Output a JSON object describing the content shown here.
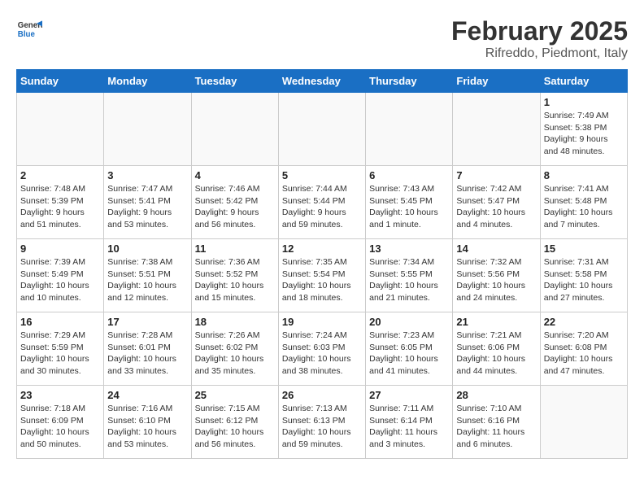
{
  "logo": {
    "line1": "General",
    "line2": "Blue"
  },
  "title": "February 2025",
  "subtitle": "Rifreddo, Piedmont, Italy",
  "days_of_week": [
    "Sunday",
    "Monday",
    "Tuesday",
    "Wednesday",
    "Thursday",
    "Friday",
    "Saturday"
  ],
  "weeks": [
    [
      {
        "day": "",
        "info": ""
      },
      {
        "day": "",
        "info": ""
      },
      {
        "day": "",
        "info": ""
      },
      {
        "day": "",
        "info": ""
      },
      {
        "day": "",
        "info": ""
      },
      {
        "day": "",
        "info": ""
      },
      {
        "day": "1",
        "info": "Sunrise: 7:49 AM\nSunset: 5:38 PM\nDaylight: 9 hours and 48 minutes."
      }
    ],
    [
      {
        "day": "2",
        "info": "Sunrise: 7:48 AM\nSunset: 5:39 PM\nDaylight: 9 hours and 51 minutes."
      },
      {
        "day": "3",
        "info": "Sunrise: 7:47 AM\nSunset: 5:41 PM\nDaylight: 9 hours and 53 minutes."
      },
      {
        "day": "4",
        "info": "Sunrise: 7:46 AM\nSunset: 5:42 PM\nDaylight: 9 hours and 56 minutes."
      },
      {
        "day": "5",
        "info": "Sunrise: 7:44 AM\nSunset: 5:44 PM\nDaylight: 9 hours and 59 minutes."
      },
      {
        "day": "6",
        "info": "Sunrise: 7:43 AM\nSunset: 5:45 PM\nDaylight: 10 hours and 1 minute."
      },
      {
        "day": "7",
        "info": "Sunrise: 7:42 AM\nSunset: 5:47 PM\nDaylight: 10 hours and 4 minutes."
      },
      {
        "day": "8",
        "info": "Sunrise: 7:41 AM\nSunset: 5:48 PM\nDaylight: 10 hours and 7 minutes."
      }
    ],
    [
      {
        "day": "9",
        "info": "Sunrise: 7:39 AM\nSunset: 5:49 PM\nDaylight: 10 hours and 10 minutes."
      },
      {
        "day": "10",
        "info": "Sunrise: 7:38 AM\nSunset: 5:51 PM\nDaylight: 10 hours and 12 minutes."
      },
      {
        "day": "11",
        "info": "Sunrise: 7:36 AM\nSunset: 5:52 PM\nDaylight: 10 hours and 15 minutes."
      },
      {
        "day": "12",
        "info": "Sunrise: 7:35 AM\nSunset: 5:54 PM\nDaylight: 10 hours and 18 minutes."
      },
      {
        "day": "13",
        "info": "Sunrise: 7:34 AM\nSunset: 5:55 PM\nDaylight: 10 hours and 21 minutes."
      },
      {
        "day": "14",
        "info": "Sunrise: 7:32 AM\nSunset: 5:56 PM\nDaylight: 10 hours and 24 minutes."
      },
      {
        "day": "15",
        "info": "Sunrise: 7:31 AM\nSunset: 5:58 PM\nDaylight: 10 hours and 27 minutes."
      }
    ],
    [
      {
        "day": "16",
        "info": "Sunrise: 7:29 AM\nSunset: 5:59 PM\nDaylight: 10 hours and 30 minutes."
      },
      {
        "day": "17",
        "info": "Sunrise: 7:28 AM\nSunset: 6:01 PM\nDaylight: 10 hours and 33 minutes."
      },
      {
        "day": "18",
        "info": "Sunrise: 7:26 AM\nSunset: 6:02 PM\nDaylight: 10 hours and 35 minutes."
      },
      {
        "day": "19",
        "info": "Sunrise: 7:24 AM\nSunset: 6:03 PM\nDaylight: 10 hours and 38 minutes."
      },
      {
        "day": "20",
        "info": "Sunrise: 7:23 AM\nSunset: 6:05 PM\nDaylight: 10 hours and 41 minutes."
      },
      {
        "day": "21",
        "info": "Sunrise: 7:21 AM\nSunset: 6:06 PM\nDaylight: 10 hours and 44 minutes."
      },
      {
        "day": "22",
        "info": "Sunrise: 7:20 AM\nSunset: 6:08 PM\nDaylight: 10 hours and 47 minutes."
      }
    ],
    [
      {
        "day": "23",
        "info": "Sunrise: 7:18 AM\nSunset: 6:09 PM\nDaylight: 10 hours and 50 minutes."
      },
      {
        "day": "24",
        "info": "Sunrise: 7:16 AM\nSunset: 6:10 PM\nDaylight: 10 hours and 53 minutes."
      },
      {
        "day": "25",
        "info": "Sunrise: 7:15 AM\nSunset: 6:12 PM\nDaylight: 10 hours and 56 minutes."
      },
      {
        "day": "26",
        "info": "Sunrise: 7:13 AM\nSunset: 6:13 PM\nDaylight: 10 hours and 59 minutes."
      },
      {
        "day": "27",
        "info": "Sunrise: 7:11 AM\nSunset: 6:14 PM\nDaylight: 11 hours and 3 minutes."
      },
      {
        "day": "28",
        "info": "Sunrise: 7:10 AM\nSunset: 6:16 PM\nDaylight: 11 hours and 6 minutes."
      },
      {
        "day": "",
        "info": ""
      }
    ]
  ]
}
